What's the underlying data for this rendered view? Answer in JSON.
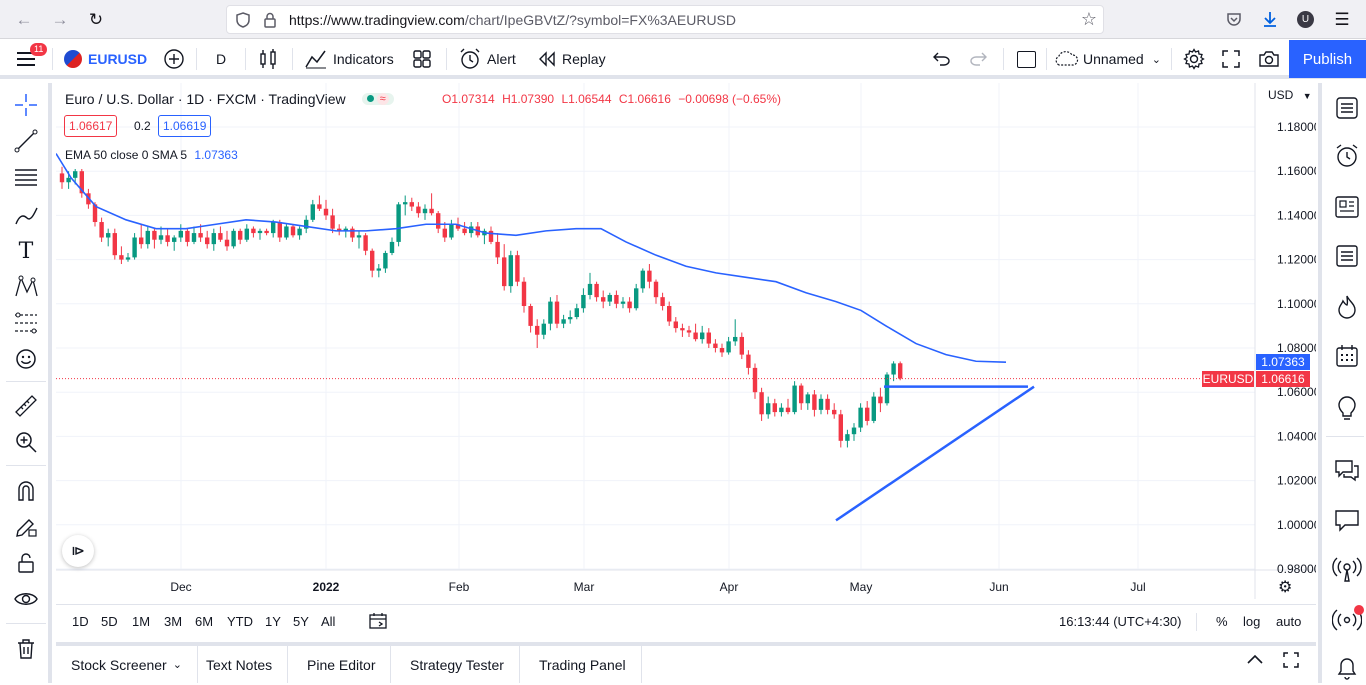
{
  "browser": {
    "url_host": "https://www.tradingview.com",
    "url_path": "/chart/IpeGBVtZ/?symbol=FX%3AEURUSD",
    "profile_initial": "U"
  },
  "topbar": {
    "menu_badge": "11",
    "symbol": "EURUSD",
    "interval": "D",
    "indicators_label": "Indicators",
    "alert_label": "Alert",
    "replay_label": "Replay",
    "layout_name": "Unnamed",
    "publish_label": "Publish"
  },
  "legend": {
    "title": "Euro / U.S. Dollar · 1D · FXCM · TradingView",
    "open": "O1.07314",
    "high": "H1.07390",
    "low": "L1.06544",
    "close": "C1.06616",
    "change": "−0.00698 (−0.65%)",
    "bid": "1.06617",
    "spread": "0.2",
    "ask": "1.06619",
    "ema_label": "EMA 50 close 0 SMA 5",
    "ema_value": "1.07363"
  },
  "price_axis": {
    "currency": "USD",
    "ticks": [
      "1.18000",
      "1.16000",
      "1.14000",
      "1.12000",
      "1.10000",
      "1.08000",
      "1.06000",
      "1.04000",
      "1.02000",
      "1.00000",
      "0.98000"
    ],
    "ema_tag": "1.07363",
    "symbol_tag": "EURUSD",
    "last_tag": "1.06616"
  },
  "time_axis": {
    "labels": [
      "Dec",
      "2022",
      "Feb",
      "Mar",
      "Apr",
      "May",
      "Jun",
      "Jul"
    ]
  },
  "colors": {
    "up": "#089981",
    "down": "#f23645",
    "ema": "#2962ff",
    "accent": "#2962ff"
  },
  "rangebar": {
    "ranges": [
      "1D",
      "5D",
      "1M",
      "3M",
      "6M",
      "YTD",
      "1Y",
      "5Y",
      "All"
    ],
    "clock": "16:13:44 (UTC+4:30)",
    "percent": "%",
    "log": "log",
    "auto": "auto"
  },
  "bottom_tabs": [
    "Stock Screener",
    "Text Notes",
    "Pine Editor",
    "Strategy Tester",
    "Trading Panel"
  ],
  "chart_data": {
    "type": "candlestick",
    "symbol": "EURUSD",
    "interval": "1D",
    "ylim": [
      0.98,
      1.18
    ],
    "x_range": [
      "2021-11-08",
      "2022-07-20"
    ],
    "candles": [
      {
        "o": 1.159,
        "h": 1.162,
        "l": 1.152,
        "c": 1.155
      },
      {
        "o": 1.155,
        "h": 1.16,
        "l": 1.152,
        "c": 1.157
      },
      {
        "o": 1.157,
        "h": 1.161,
        "l": 1.154,
        "c": 1.16
      },
      {
        "o": 1.16,
        "h": 1.161,
        "l": 1.148,
        "c": 1.15
      },
      {
        "o": 1.15,
        "h": 1.152,
        "l": 1.143,
        "c": 1.145
      },
      {
        "o": 1.145,
        "h": 1.146,
        "l": 1.135,
        "c": 1.137
      },
      {
        "o": 1.137,
        "h": 1.139,
        "l": 1.128,
        "c": 1.13
      },
      {
        "o": 1.13,
        "h": 1.134,
        "l": 1.126,
        "c": 1.132
      },
      {
        "o": 1.132,
        "h": 1.134,
        "l": 1.12,
        "c": 1.122
      },
      {
        "o": 1.122,
        "h": 1.126,
        "l": 1.118,
        "c": 1.12
      },
      {
        "o": 1.12,
        "h": 1.123,
        "l": 1.119,
        "c": 1.121
      },
      {
        "o": 1.121,
        "h": 1.132,
        "l": 1.12,
        "c": 1.13
      },
      {
        "o": 1.13,
        "h": 1.136,
        "l": 1.125,
        "c": 1.127
      },
      {
        "o": 1.127,
        "h": 1.135,
        "l": 1.125,
        "c": 1.133
      },
      {
        "o": 1.133,
        "h": 1.134,
        "l": 1.125,
        "c": 1.129
      },
      {
        "o": 1.129,
        "h": 1.135,
        "l": 1.127,
        "c": 1.131
      },
      {
        "o": 1.131,
        "h": 1.134,
        "l": 1.126,
        "c": 1.128
      },
      {
        "o": 1.128,
        "h": 1.131,
        "l": 1.124,
        "c": 1.13
      },
      {
        "o": 1.13,
        "h": 1.136,
        "l": 1.128,
        "c": 1.133
      },
      {
        "o": 1.133,
        "h": 1.134,
        "l": 1.126,
        "c": 1.128
      },
      {
        "o": 1.128,
        "h": 1.135,
        "l": 1.127,
        "c": 1.132
      },
      {
        "o": 1.132,
        "h": 1.136,
        "l": 1.128,
        "c": 1.13
      },
      {
        "o": 1.13,
        "h": 1.133,
        "l": 1.125,
        "c": 1.127
      },
      {
        "o": 1.127,
        "h": 1.134,
        "l": 1.124,
        "c": 1.132
      },
      {
        "o": 1.132,
        "h": 1.135,
        "l": 1.128,
        "c": 1.129
      },
      {
        "o": 1.129,
        "h": 1.133,
        "l": 1.124,
        "c": 1.126
      },
      {
        "o": 1.126,
        "h": 1.134,
        "l": 1.125,
        "c": 1.133
      },
      {
        "o": 1.133,
        "h": 1.134,
        "l": 1.127,
        "c": 1.129
      },
      {
        "o": 1.129,
        "h": 1.136,
        "l": 1.128,
        "c": 1.134
      },
      {
        "o": 1.134,
        "h": 1.135,
        "l": 1.13,
        "c": 1.132
      },
      {
        "o": 1.132,
        "h": 1.134,
        "l": 1.129,
        "c": 1.133
      },
      {
        "o": 1.133,
        "h": 1.134,
        "l": 1.131,
        "c": 1.132
      },
      {
        "o": 1.132,
        "h": 1.138,
        "l": 1.13,
        "c": 1.137
      },
      {
        "o": 1.137,
        "h": 1.138,
        "l": 1.128,
        "c": 1.13
      },
      {
        "o": 1.13,
        "h": 1.136,
        "l": 1.129,
        "c": 1.135
      },
      {
        "o": 1.135,
        "h": 1.136,
        "l": 1.13,
        "c": 1.131
      },
      {
        "o": 1.131,
        "h": 1.135,
        "l": 1.129,
        "c": 1.134
      },
      {
        "o": 1.134,
        "h": 1.14,
        "l": 1.132,
        "c": 1.138
      },
      {
        "o": 1.138,
        "h": 1.147,
        "l": 1.137,
        "c": 1.145
      },
      {
        "o": 1.145,
        "h": 1.149,
        "l": 1.142,
        "c": 1.143
      },
      {
        "o": 1.143,
        "h": 1.147,
        "l": 1.138,
        "c": 1.14
      },
      {
        "o": 1.14,
        "h": 1.143,
        "l": 1.132,
        "c": 1.134
      },
      {
        "o": 1.134,
        "h": 1.136,
        "l": 1.131,
        "c": 1.133
      },
      {
        "o": 1.133,
        "h": 1.135,
        "l": 1.13,
        "c": 1.134
      },
      {
        "o": 1.134,
        "h": 1.135,
        "l": 1.128,
        "c": 1.13
      },
      {
        "o": 1.13,
        "h": 1.133,
        "l": 1.125,
        "c": 1.131
      },
      {
        "o": 1.131,
        "h": 1.132,
        "l": 1.122,
        "c": 1.124
      },
      {
        "o": 1.124,
        "h": 1.125,
        "l": 1.112,
        "c": 1.115
      },
      {
        "o": 1.115,
        "h": 1.118,
        "l": 1.112,
        "c": 1.116
      },
      {
        "o": 1.116,
        "h": 1.124,
        "l": 1.114,
        "c": 1.123
      },
      {
        "o": 1.123,
        "h": 1.13,
        "l": 1.122,
        "c": 1.128
      },
      {
        "o": 1.128,
        "h": 1.146,
        "l": 1.126,
        "c": 1.145
      },
      {
        "o": 1.145,
        "h": 1.149,
        "l": 1.14,
        "c": 1.146
      },
      {
        "o": 1.146,
        "h": 1.148,
        "l": 1.142,
        "c": 1.144
      },
      {
        "o": 1.144,
        "h": 1.146,
        "l": 1.139,
        "c": 1.141
      },
      {
        "o": 1.141,
        "h": 1.145,
        "l": 1.138,
        "c": 1.143
      },
      {
        "o": 1.143,
        "h": 1.15,
        "l": 1.14,
        "c": 1.141
      },
      {
        "o": 1.141,
        "h": 1.142,
        "l": 1.132,
        "c": 1.134
      },
      {
        "o": 1.134,
        "h": 1.137,
        "l": 1.128,
        "c": 1.13
      },
      {
        "o": 1.13,
        "h": 1.138,
        "l": 1.129,
        "c": 1.136
      },
      {
        "o": 1.136,
        "h": 1.139,
        "l": 1.133,
        "c": 1.134
      },
      {
        "o": 1.134,
        "h": 1.137,
        "l": 1.131,
        "c": 1.132
      },
      {
        "o": 1.132,
        "h": 1.137,
        "l": 1.13,
        "c": 1.135
      },
      {
        "o": 1.135,
        "h": 1.137,
        "l": 1.13,
        "c": 1.131
      },
      {
        "o": 1.131,
        "h": 1.134,
        "l": 1.127,
        "c": 1.133
      },
      {
        "o": 1.133,
        "h": 1.135,
        "l": 1.127,
        "c": 1.128
      },
      {
        "o": 1.128,
        "h": 1.132,
        "l": 1.118,
        "c": 1.121
      },
      {
        "o": 1.121,
        "h": 1.127,
        "l": 1.106,
        "c": 1.108
      },
      {
        "o": 1.108,
        "h": 1.124,
        "l": 1.105,
        "c": 1.122
      },
      {
        "o": 1.122,
        "h": 1.124,
        "l": 1.108,
        "c": 1.11
      },
      {
        "o": 1.11,
        "h": 1.112,
        "l": 1.096,
        "c": 1.099
      },
      {
        "o": 1.099,
        "h": 1.1,
        "l": 1.087,
        "c": 1.09
      },
      {
        "o": 1.09,
        "h": 1.093,
        "l": 1.08,
        "c": 1.086
      },
      {
        "o": 1.086,
        "h": 1.093,
        "l": 1.084,
        "c": 1.091
      },
      {
        "o": 1.091,
        "h": 1.103,
        "l": 1.088,
        "c": 1.101
      },
      {
        "o": 1.101,
        "h": 1.104,
        "l": 1.089,
        "c": 1.091
      },
      {
        "o": 1.091,
        "h": 1.095,
        "l": 1.089,
        "c": 1.093
      },
      {
        "o": 1.093,
        "h": 1.097,
        "l": 1.091,
        "c": 1.094
      },
      {
        "o": 1.094,
        "h": 1.1,
        "l": 1.093,
        "c": 1.098
      },
      {
        "o": 1.098,
        "h": 1.107,
        "l": 1.096,
        "c": 1.104
      },
      {
        "o": 1.104,
        "h": 1.114,
        "l": 1.102,
        "c": 1.109
      },
      {
        "o": 1.109,
        "h": 1.11,
        "l": 1.101,
        "c": 1.103
      },
      {
        "o": 1.103,
        "h": 1.106,
        "l": 1.098,
        "c": 1.101
      },
      {
        "o": 1.101,
        "h": 1.105,
        "l": 1.099,
        "c": 1.104
      },
      {
        "o": 1.104,
        "h": 1.106,
        "l": 1.098,
        "c": 1.1
      },
      {
        "o": 1.1,
        "h": 1.103,
        "l": 1.098,
        "c": 1.101
      },
      {
        "o": 1.101,
        "h": 1.103,
        "l": 1.096,
        "c": 1.098
      },
      {
        "o": 1.098,
        "h": 1.109,
        "l": 1.097,
        "c": 1.107
      },
      {
        "o": 1.107,
        "h": 1.116,
        "l": 1.105,
        "c": 1.115
      },
      {
        "o": 1.115,
        "h": 1.118,
        "l": 1.107,
        "c": 1.11
      },
      {
        "o": 1.11,
        "h": 1.111,
        "l": 1.1,
        "c": 1.103
      },
      {
        "o": 1.103,
        "h": 1.105,
        "l": 1.097,
        "c": 1.099
      },
      {
        "o": 1.099,
        "h": 1.101,
        "l": 1.09,
        "c": 1.092
      },
      {
        "o": 1.092,
        "h": 1.094,
        "l": 1.087,
        "c": 1.089
      },
      {
        "o": 1.089,
        "h": 1.091,
        "l": 1.085,
        "c": 1.088
      },
      {
        "o": 1.088,
        "h": 1.09,
        "l": 1.085,
        "c": 1.087
      },
      {
        "o": 1.087,
        "h": 1.091,
        "l": 1.083,
        "c": 1.084
      },
      {
        "o": 1.084,
        "h": 1.09,
        "l": 1.082,
        "c": 1.087
      },
      {
        "o": 1.087,
        "h": 1.089,
        "l": 1.08,
        "c": 1.082
      },
      {
        "o": 1.082,
        "h": 1.084,
        "l": 1.078,
        "c": 1.08
      },
      {
        "o": 1.08,
        "h": 1.082,
        "l": 1.076,
        "c": 1.078
      },
      {
        "o": 1.078,
        "h": 1.085,
        "l": 1.077,
        "c": 1.083
      },
      {
        "o": 1.083,
        "h": 1.093,
        "l": 1.081,
        "c": 1.085
      },
      {
        "o": 1.085,
        "h": 1.087,
        "l": 1.075,
        "c": 1.077
      },
      {
        "o": 1.077,
        "h": 1.079,
        "l": 1.068,
        "c": 1.071
      },
      {
        "o": 1.071,
        "h": 1.073,
        "l": 1.057,
        "c": 1.06
      },
      {
        "o": 1.06,
        "h": 1.062,
        "l": 1.047,
        "c": 1.05
      },
      {
        "o": 1.05,
        "h": 1.058,
        "l": 1.048,
        "c": 1.055
      },
      {
        "o": 1.055,
        "h": 1.057,
        "l": 1.049,
        "c": 1.051
      },
      {
        "o": 1.051,
        "h": 1.055,
        "l": 1.049,
        "c": 1.053
      },
      {
        "o": 1.053,
        "h": 1.057,
        "l": 1.05,
        "c": 1.051
      },
      {
        "o": 1.051,
        "h": 1.065,
        "l": 1.05,
        "c": 1.063
      },
      {
        "o": 1.063,
        "h": 1.064,
        "l": 1.052,
        "c": 1.055
      },
      {
        "o": 1.055,
        "h": 1.06,
        "l": 1.052,
        "c": 1.059
      },
      {
        "o": 1.059,
        "h": 1.061,
        "l": 1.049,
        "c": 1.052
      },
      {
        "o": 1.052,
        "h": 1.059,
        "l": 1.05,
        "c": 1.057
      },
      {
        "o": 1.057,
        "h": 1.059,
        "l": 1.05,
        "c": 1.052
      },
      {
        "o": 1.052,
        "h": 1.055,
        "l": 1.048,
        "c": 1.05
      },
      {
        "o": 1.05,
        "h": 1.052,
        "l": 1.035,
        "c": 1.038
      },
      {
        "o": 1.038,
        "h": 1.043,
        "l": 1.035,
        "c": 1.041
      },
      {
        "o": 1.041,
        "h": 1.046,
        "l": 1.038,
        "c": 1.044
      },
      {
        "o": 1.044,
        "h": 1.055,
        "l": 1.042,
        "c": 1.053
      },
      {
        "o": 1.053,
        "h": 1.056,
        "l": 1.045,
        "c": 1.047
      },
      {
        "o": 1.047,
        "h": 1.06,
        "l": 1.046,
        "c": 1.058
      },
      {
        "o": 1.058,
        "h": 1.062,
        "l": 1.051,
        "c": 1.055
      },
      {
        "o": 1.055,
        "h": 1.069,
        "l": 1.054,
        "c": 1.068
      },
      {
        "o": 1.068,
        "h": 1.074,
        "l": 1.065,
        "c": 1.073
      },
      {
        "o": 1.0731,
        "h": 1.0739,
        "l": 1.0654,
        "c": 1.0662
      }
    ],
    "ema": [
      [
        0,
        1.168
      ],
      [
        15,
        1.157
      ],
      [
        40,
        1.144
      ],
      [
        70,
        1.138
      ],
      [
        100,
        1.134
      ],
      [
        130,
        1.134
      ],
      [
        160,
        1.136
      ],
      [
        190,
        1.138
      ],
      [
        220,
        1.137
      ],
      [
        250,
        1.135
      ],
      [
        280,
        1.133
      ],
      [
        310,
        1.133
      ],
      [
        340,
        1.134
      ],
      [
        370,
        1.136
      ],
      [
        400,
        1.136
      ],
      [
        430,
        1.132
      ],
      [
        460,
        1.131
      ],
      [
        490,
        1.133
      ],
      [
        520,
        1.134
      ],
      [
        545,
        1.134
      ],
      [
        570,
        1.128
      ],
      [
        600,
        1.122
      ],
      [
        630,
        1.117
      ],
      [
        660,
        1.114
      ],
      [
        690,
        1.112
      ],
      [
        720,
        1.11
      ],
      [
        750,
        1.105
      ],
      [
        780,
        1.101
      ],
      [
        805,
        1.097
      ],
      [
        830,
        1.09
      ],
      [
        860,
        1.082
      ],
      [
        890,
        1.077
      ],
      [
        920,
        1.074
      ],
      [
        950,
        1.0736
      ]
    ],
    "last_price": 1.06616,
    "ema_last": 1.07363,
    "drawings": {
      "horizontal": {
        "x1": 828,
        "x2": 972,
        "y": 1.0625
      },
      "trendline": {
        "x1": 780,
        "y1": 1.002,
        "x2": 978,
        "y2": 1.0625
      }
    }
  }
}
